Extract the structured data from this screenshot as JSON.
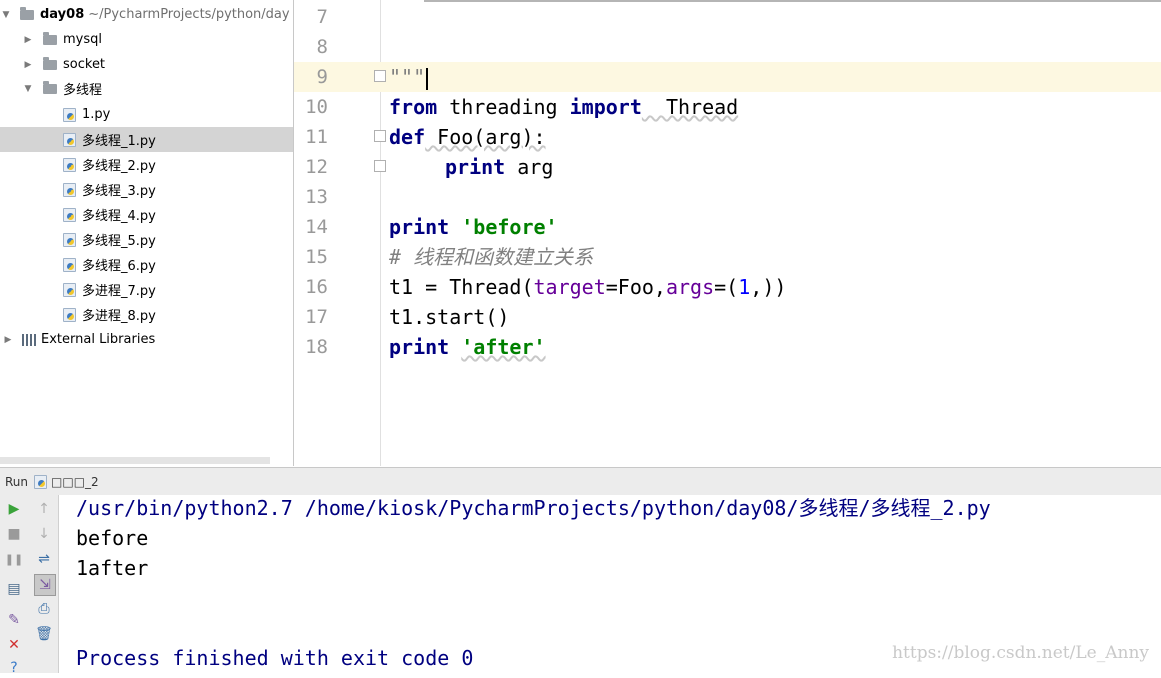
{
  "tree": {
    "root": {
      "name": "day08",
      "path": "~/PycharmProjects/python/day"
    },
    "items": [
      {
        "label": "mysql"
      },
      {
        "label": "socket"
      },
      {
        "label": "多线程"
      },
      {
        "label": "1.py"
      },
      {
        "label": "多线程_1.py"
      },
      {
        "label": "多线程_2.py"
      },
      {
        "label": "多线程_3.py"
      },
      {
        "label": "多线程_4.py"
      },
      {
        "label": "多线程_5.py"
      },
      {
        "label": "多线程_6.py"
      },
      {
        "label": "多进程_7.py"
      },
      {
        "label": "多进程_8.py"
      }
    ],
    "external": "External Libraries"
  },
  "editor": {
    "line_numbers": [
      "7",
      "8",
      "9",
      "10",
      "11",
      "12",
      "13",
      "14",
      "15",
      "16",
      "17",
      "18"
    ],
    "tokens": {
      "docstring": "\"\"\"",
      "from": "from",
      "threading": " threading ",
      "import": "import",
      "thread": "  Thread",
      "def": "def",
      "foo_sig": " Foo(arg):",
      "print_kw": "print",
      "arg": " arg",
      "before": "'before'",
      "comment": "# 线程和函数建立关系",
      "t1_assign": "t1 = Thread(",
      "target": "target",
      "eq_foo": "=Foo,",
      "args": "args",
      "eq_paren": "=(",
      "one": "1",
      "close": ",))",
      "t1_start": "t1.start()",
      "after": "'after'"
    }
  },
  "run": {
    "label": "Run",
    "config": "□□□_2",
    "output": [
      "/usr/bin/python2.7 /home/kiosk/PycharmProjects/python/day08/多线程/多线程_2.py",
      "before",
      "1after",
      "Process finished with exit code 0"
    ]
  },
  "watermark": "https://blog.csdn.net/Le_Anny"
}
